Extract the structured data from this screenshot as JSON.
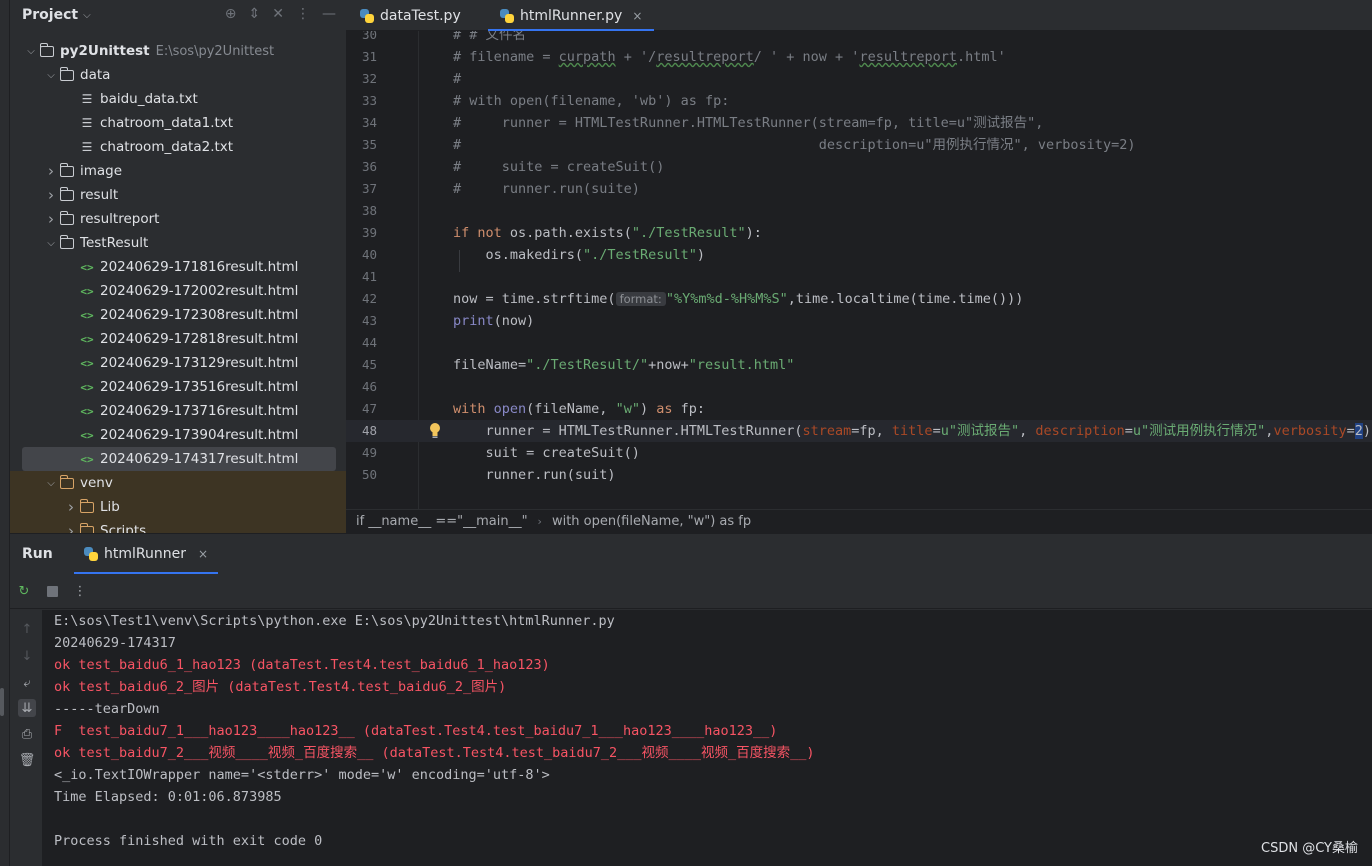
{
  "project": {
    "title": "Project",
    "tree": [
      {
        "depth": 0,
        "arrow": "open",
        "icon": "folder",
        "label": "py2Unittest",
        "path": "E:\\sos\\py2Unittest",
        "bold": true
      },
      {
        "depth": 1,
        "arrow": "open",
        "icon": "folder",
        "label": "data"
      },
      {
        "depth": 2,
        "arrow": "none",
        "icon": "text",
        "label": "baidu_data.txt"
      },
      {
        "depth": 2,
        "arrow": "none",
        "icon": "text",
        "label": "chatroom_data1.txt"
      },
      {
        "depth": 2,
        "arrow": "none",
        "icon": "text",
        "label": "chatroom_data2.txt"
      },
      {
        "depth": 1,
        "arrow": "closed",
        "icon": "folder",
        "label": "image"
      },
      {
        "depth": 1,
        "arrow": "closed",
        "icon": "folder",
        "label": "result"
      },
      {
        "depth": 1,
        "arrow": "closed",
        "icon": "folder",
        "label": "resultreport"
      },
      {
        "depth": 1,
        "arrow": "open",
        "icon": "folder",
        "label": "TestResult"
      },
      {
        "depth": 2,
        "arrow": "none",
        "icon": "html",
        "label": "20240629-171816result.html"
      },
      {
        "depth": 2,
        "arrow": "none",
        "icon": "html",
        "label": "20240629-172002result.html"
      },
      {
        "depth": 2,
        "arrow": "none",
        "icon": "html",
        "label": "20240629-172308result.html"
      },
      {
        "depth": 2,
        "arrow": "none",
        "icon": "html",
        "label": "20240629-172818result.html"
      },
      {
        "depth": 2,
        "arrow": "none",
        "icon": "html",
        "label": "20240629-173129result.html"
      },
      {
        "depth": 2,
        "arrow": "none",
        "icon": "html",
        "label": "20240629-173516result.html"
      },
      {
        "depth": 2,
        "arrow": "none",
        "icon": "html",
        "label": "20240629-173716result.html"
      },
      {
        "depth": 2,
        "arrow": "none",
        "icon": "html",
        "label": "20240629-173904result.html"
      },
      {
        "depth": 2,
        "arrow": "none",
        "icon": "html",
        "label": "20240629-174317result.html",
        "selected": true
      },
      {
        "depth": 1,
        "arrow": "open",
        "icon": "folder-venv",
        "label": "venv"
      },
      {
        "depth": 2,
        "arrow": "closed",
        "icon": "folder-venv",
        "label": "Lib"
      },
      {
        "depth": 2,
        "arrow": "closed",
        "icon": "folder-venv",
        "label": "Scripts"
      }
    ]
  },
  "tabs": [
    {
      "label": "dataTest.py",
      "active": false
    },
    {
      "label": "htmlRunner.py",
      "active": true,
      "close": "×"
    }
  ],
  "editor": {
    "lines": [
      {
        "n": "30",
        "segs": [
          [
            "cm",
            "# # 文件名"
          ]
        ]
      },
      {
        "n": "31",
        "segs": [
          [
            "cm",
            "# filename = "
          ],
          [
            "cmw",
            "curpath"
          ],
          [
            "cm",
            " + '/"
          ],
          [
            "cmw",
            "resultreport"
          ],
          [
            "cm",
            "/ ' + now + '"
          ],
          [
            "cmw",
            "resultreport"
          ],
          [
            "cm",
            ".html'"
          ]
        ]
      },
      {
        "n": "32",
        "segs": [
          [
            "cm",
            "#"
          ]
        ]
      },
      {
        "n": "33",
        "segs": [
          [
            "cm",
            "# with open(filename, 'wb') as fp:"
          ]
        ]
      },
      {
        "n": "34",
        "segs": [
          [
            "cm",
            "#     runner = HTMLTestRunner.HTMLTestRunner(stream=fp, title=u\"测试报告\","
          ]
        ]
      },
      {
        "n": "35",
        "segs": [
          [
            "cm",
            "#                                            description=u\"用例执行情况\", verbosity=2)"
          ]
        ]
      },
      {
        "n": "36",
        "segs": [
          [
            "cm",
            "#     suite = createSuit()"
          ]
        ]
      },
      {
        "n": "37",
        "segs": [
          [
            "cm",
            "#     runner.run(suite)"
          ]
        ]
      },
      {
        "n": "38",
        "segs": []
      },
      {
        "n": "39",
        "segs": [
          [
            "kw",
            "if not "
          ],
          [
            "pl",
            "os.path.exists("
          ],
          [
            "st",
            "\"./TestResult\""
          ],
          [
            "pl",
            "):"
          ]
        ]
      },
      {
        "n": "40",
        "segs": [
          [
            "pl",
            "    os.makedirs("
          ],
          [
            "st",
            "\"./TestResult\""
          ],
          [
            "pl",
            ")"
          ]
        ]
      },
      {
        "n": "41",
        "segs": []
      },
      {
        "n": "42",
        "segs": [
          [
            "pl",
            "now = time.strftime("
          ],
          [
            "hint",
            "format:"
          ],
          [
            "st",
            "\"%Y%m%d-%H%M%S\""
          ],
          [
            "pl",
            ",time.localtime(time.time()))"
          ]
        ]
      },
      {
        "n": "43",
        "segs": [
          [
            "bi",
            "print"
          ],
          [
            "pl",
            "(now)"
          ]
        ]
      },
      {
        "n": "44",
        "segs": []
      },
      {
        "n": "45",
        "segs": [
          [
            "pl",
            "fileName="
          ],
          [
            "st",
            "\"./TestResult/\""
          ],
          [
            "pl",
            "+now+"
          ],
          [
            "st",
            "\"result.html\""
          ]
        ]
      },
      {
        "n": "46",
        "segs": []
      },
      {
        "n": "47",
        "segs": [
          [
            "kw",
            "with "
          ],
          [
            "bi",
            "open"
          ],
          [
            "pl",
            "(fileName, "
          ],
          [
            "st",
            "\"w\""
          ],
          [
            "pl",
            ") "
          ],
          [
            "kw",
            "as "
          ],
          [
            "pl",
            "fp:"
          ]
        ]
      },
      {
        "n": "48",
        "current": true,
        "segs": [
          [
            "pl",
            "    runner = HTMLTestRunner.HTMLTestRunner("
          ],
          [
            "pa",
            "stream"
          ],
          [
            "pl",
            "=fp, "
          ],
          [
            "pa",
            "title"
          ],
          [
            "pl",
            "="
          ],
          [
            "st",
            "u\"测试报告\""
          ],
          [
            "pl",
            ", "
          ],
          [
            "pa",
            "description"
          ],
          [
            "pl",
            "="
          ],
          [
            "st",
            "u\"测试用例执行情况\""
          ],
          [
            "pl",
            ","
          ],
          [
            "pa",
            "verbosity"
          ],
          [
            "pl",
            "="
          ],
          [
            "sel",
            "2"
          ],
          [
            "pl",
            ")"
          ]
        ]
      },
      {
        "n": "49",
        "segs": [
          [
            "pl",
            "    suit = createSuit()"
          ]
        ]
      },
      {
        "n": "50",
        "segs": [
          [
            "pl",
            "    runner.run(suit)"
          ]
        ]
      }
    ]
  },
  "breadcrumb": {
    "items": [
      "if __name__ ==\"__main__\"",
      "with open(fileName, \"w\") as fp"
    ]
  },
  "run": {
    "title": "Run",
    "tab_label": "htmlRunner",
    "tab_close": "×",
    "console": [
      {
        "text": "E:\\sos\\Test1\\venv\\Scripts\\python.exe E:\\sos\\py2Unittest\\htmlRunner.py",
        "err": false
      },
      {
        "text": "20240629-174317",
        "err": false
      },
      {
        "text": "ok test_baidu6_1_hao123 (dataTest.Test4.test_baidu6_1_hao123)",
        "err": true
      },
      {
        "text": "ok test_baidu6_2_图片 (dataTest.Test4.test_baidu6_2_图片)",
        "err": true
      },
      {
        "text": "-----tearDown",
        "err": false
      },
      {
        "text": "F  test_baidu7_1___hao123____hao123__ (dataTest.Test4.test_baidu7_1___hao123____hao123__)",
        "err": true
      },
      {
        "text": "ok test_baidu7_2___视频____视频_百度搜索__ (dataTest.Test4.test_baidu7_2___视频____视频_百度搜索__)",
        "err": true
      },
      {
        "text": "<_io.TextIOWrapper name='<stderr>' mode='w' encoding='utf-8'>",
        "err": false
      },
      {
        "text": "Time Elapsed: 0:01:06.873985",
        "err": false
      },
      {
        "text": "",
        "err": false
      },
      {
        "text": "Process finished with exit code 0",
        "err": false
      }
    ]
  },
  "watermark": "CSDN @CY桑榆"
}
